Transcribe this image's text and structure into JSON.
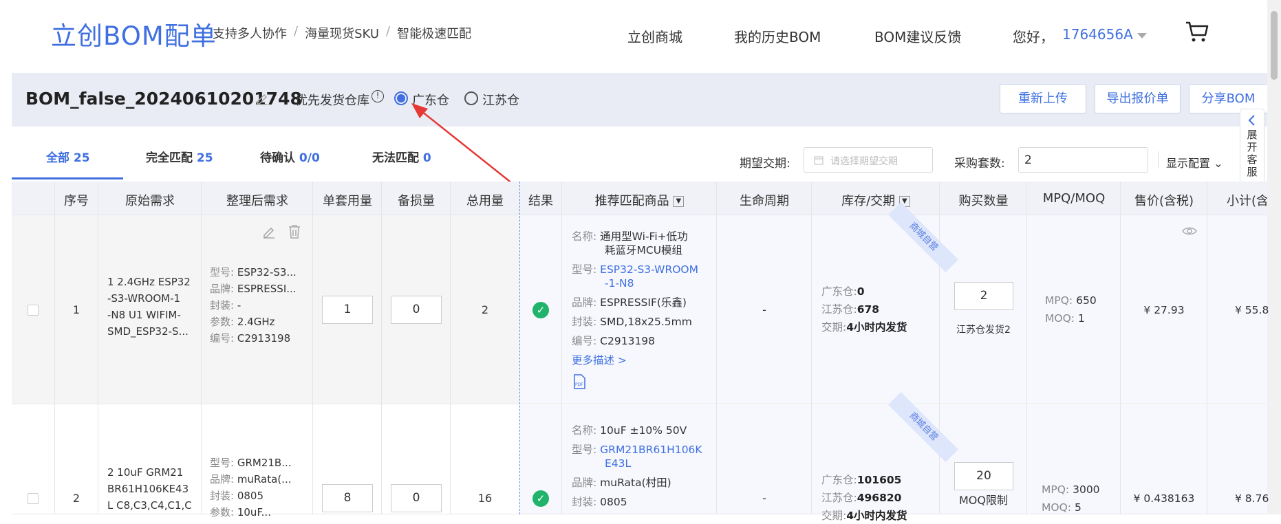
{
  "header": {
    "logo": "立创BOM配单",
    "taglines": [
      "支持多人协作",
      "海量现货SKU",
      "智能极速匹配"
    ],
    "nav": [
      "立创商城",
      "我的历史BOM",
      "BOM建议反馈"
    ],
    "greeting": "您好，",
    "user": "1764656A"
  },
  "bom": {
    "name": "BOM_false_20240610201748",
    "warehouse_label": "优先发货仓库",
    "warehouses": [
      "广东仓",
      "江苏仓"
    ],
    "selected": "广东仓",
    "buttons": [
      "重新上传",
      "导出报价单",
      "分享BOM"
    ],
    "side_panel": [
      "展",
      "开",
      "客",
      "服"
    ]
  },
  "tabs": [
    {
      "label": "全部",
      "count": "25"
    },
    {
      "label": "完全匹配",
      "count": "25"
    },
    {
      "label": "待确认",
      "count": "0/0"
    },
    {
      "label": "无法匹配",
      "count": "0"
    }
  ],
  "filters": {
    "delivery_label": "期望交期:",
    "delivery_placeholder": "请选择期望交期",
    "sets_label": "采购套数:",
    "sets_value": "2",
    "config_label": "显示配置"
  },
  "columns": [
    "序号",
    "原始需求",
    "整理后需求",
    "单套用量",
    "备损量",
    "总用量",
    "结果",
    "推荐匹配商品",
    "生命周期",
    "库存/交期",
    "购买数量",
    "MPQ/MOQ",
    "售价(含税)",
    "小计(含"
  ],
  "rows": [
    {
      "no": "1",
      "raw": [
        "1 2.4GHz ESP32",
        "-S3-WROOM-1",
        "-N8 U1 WIFIM-",
        "SMD_ESP32-S..."
      ],
      "clean": [
        [
          "型号:",
          "ESP32-S3..."
        ],
        [
          "品牌:",
          "ESPRESSI..."
        ],
        [
          "封装:",
          "-"
        ],
        [
          "参数:",
          "2.4GHz"
        ],
        [
          "编号:",
          "C2913198"
        ]
      ],
      "unit": "1",
      "spare": "0",
      "total": "2",
      "product": {
        "name": [
          "名称:",
          "通用型Wi-Fi+低功",
          "耗蓝牙MCU模组"
        ],
        "model": [
          "型号:",
          "ESP32-S3-WROOM",
          "-1-N8"
        ],
        "brand": [
          "品牌:",
          "ESPRESSIF(乐鑫)"
        ],
        "pkg": [
          "封装:",
          "SMD,18x25.5mm"
        ],
        "code": [
          "编号:",
          "C2913198"
        ],
        "more": "更多描述 >"
      },
      "lifecycle": "-",
      "stock": [
        [
          "广东仓:",
          "0"
        ],
        [
          "江苏仓:",
          "678"
        ],
        [
          "交期:",
          "4小时内发货"
        ]
      ],
      "ribbon": "商城自营",
      "qty": "2",
      "qty_note": "江苏仓发货2",
      "mpq": [
        "MPQ:",
        "650"
      ],
      "moq": [
        "MOQ:",
        "1"
      ],
      "price": "¥ 27.93",
      "subtotal": "¥ 55.8"
    },
    {
      "no": "2",
      "raw": [
        "2 10uF GRM21",
        "BR61H106KE43",
        "L C8,C3,C4,C1,C"
      ],
      "clean": [
        [
          "型号:",
          "GRM21B..."
        ],
        [
          "品牌:",
          "muRata(..."
        ],
        [
          "封装:",
          "0805"
        ],
        [
          "参数:",
          "10uF..."
        ]
      ],
      "unit": "8",
      "spare": "0",
      "total": "16",
      "product": {
        "name": [
          "名称:",
          "10uF ±10% 50V"
        ],
        "model": [
          "型号:",
          "GRM21BR61H106K",
          "E43L"
        ],
        "brand": [
          "品牌:",
          "muRata(村田)"
        ],
        "pkg": [
          "封装:",
          "0805"
        ]
      },
      "lifecycle": "-",
      "stock": [
        [
          "广东仓:",
          "101605"
        ],
        [
          "江苏仓:",
          "496820"
        ],
        [
          "交期:",
          "4小时内发货"
        ]
      ],
      "ribbon": "商城自营",
      "qty": "20",
      "qty_note": "MOQ限制",
      "mpq": [
        "MPQ:",
        "3000"
      ],
      "moq": [
        "MOQ:",
        "5"
      ],
      "price": "¥ 0.438163",
      "subtotal": "¥ 8.76"
    }
  ]
}
